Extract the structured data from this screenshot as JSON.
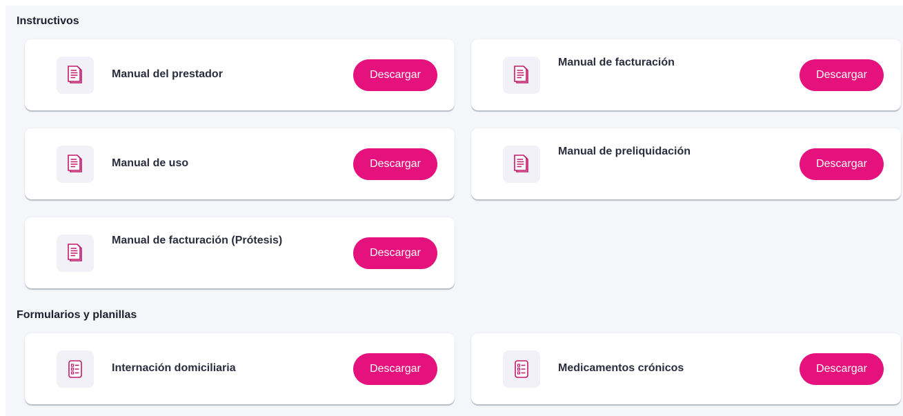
{
  "colors": {
    "accent": "#e5127d",
    "icon_stroke": "#c2186b",
    "background": "#f4f6f9",
    "card": "#ffffff"
  },
  "sections": [
    {
      "title": "Instructivos",
      "items": [
        {
          "title": "Manual del prestador",
          "button": "Descargar",
          "icon": "document-icon"
        },
        {
          "title": "Manual de facturación",
          "button": "Descargar",
          "icon": "document-icon"
        },
        {
          "title": "Manual de uso",
          "button": "Descargar",
          "icon": "document-icon"
        },
        {
          "title": "Manual de preliquidación",
          "button": "Descargar",
          "icon": "document-icon"
        },
        {
          "title": "Manual de facturación (Prótesis)",
          "button": "Descargar",
          "icon": "document-icon"
        }
      ]
    },
    {
      "title": "Formularios y planillas",
      "items": [
        {
          "title": "Internación domiciliaria",
          "button": "Descargar",
          "icon": "checklist-icon"
        },
        {
          "title": "Medicamentos crónicos",
          "button": "Descargar",
          "icon": "checklist-icon"
        }
      ]
    }
  ]
}
